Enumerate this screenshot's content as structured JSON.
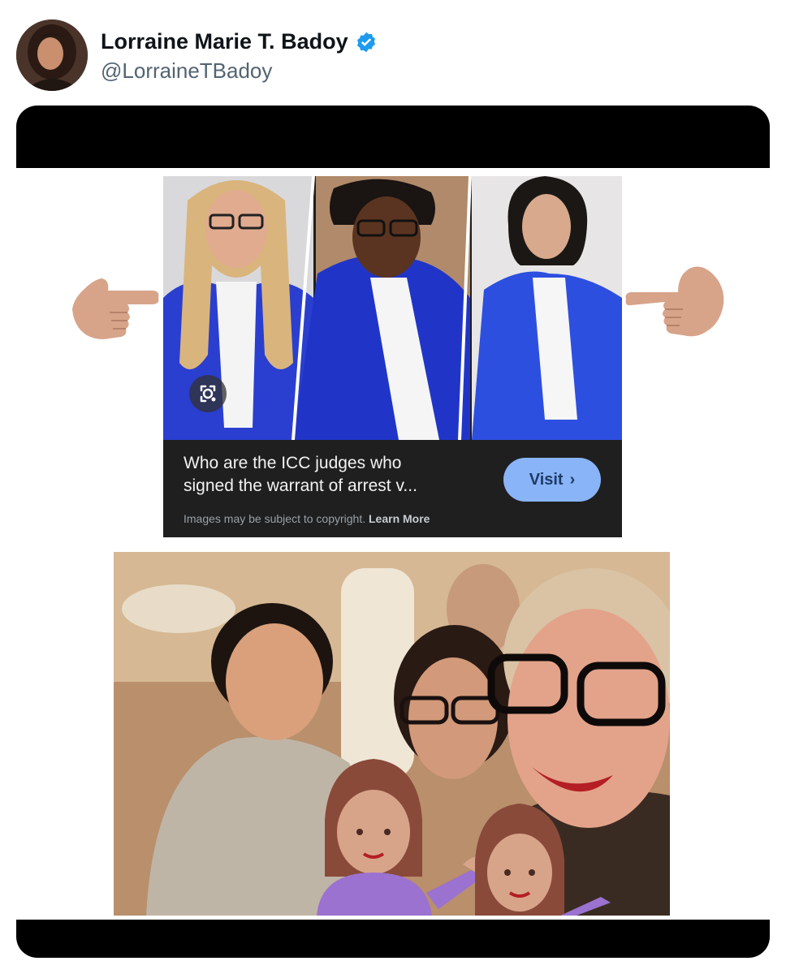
{
  "post": {
    "author_name": "Lorraine Marie T. Badoy",
    "author_handle": "@LorraineTBadoy",
    "verified_color": "#1d9bf0"
  },
  "search_card": {
    "caption_line1": "Who are the ICC judges who",
    "caption_line2": "signed the warrant of arrest v...",
    "visit_label": "Visit",
    "visit_chevron": "›",
    "copyright_text": "Images may be subject to copyright.",
    "learn_more": "Learn More"
  },
  "icons": {
    "left_pointer": "backhand-index-pointing-left-emoji",
    "right_pointer": "backhand-index-pointing-right-emoji",
    "lens": "google-lens-icon",
    "person_tipping_hand": "woman-tipping-hand-emoji"
  },
  "colors": {
    "robe_blue": "#2a3fd0",
    "visit_bg": "#8ab4f8",
    "skin_emoji": "#d7a48a",
    "emoji_purple": "#9b72cf",
    "emoji_hair": "#8a4a3a"
  }
}
